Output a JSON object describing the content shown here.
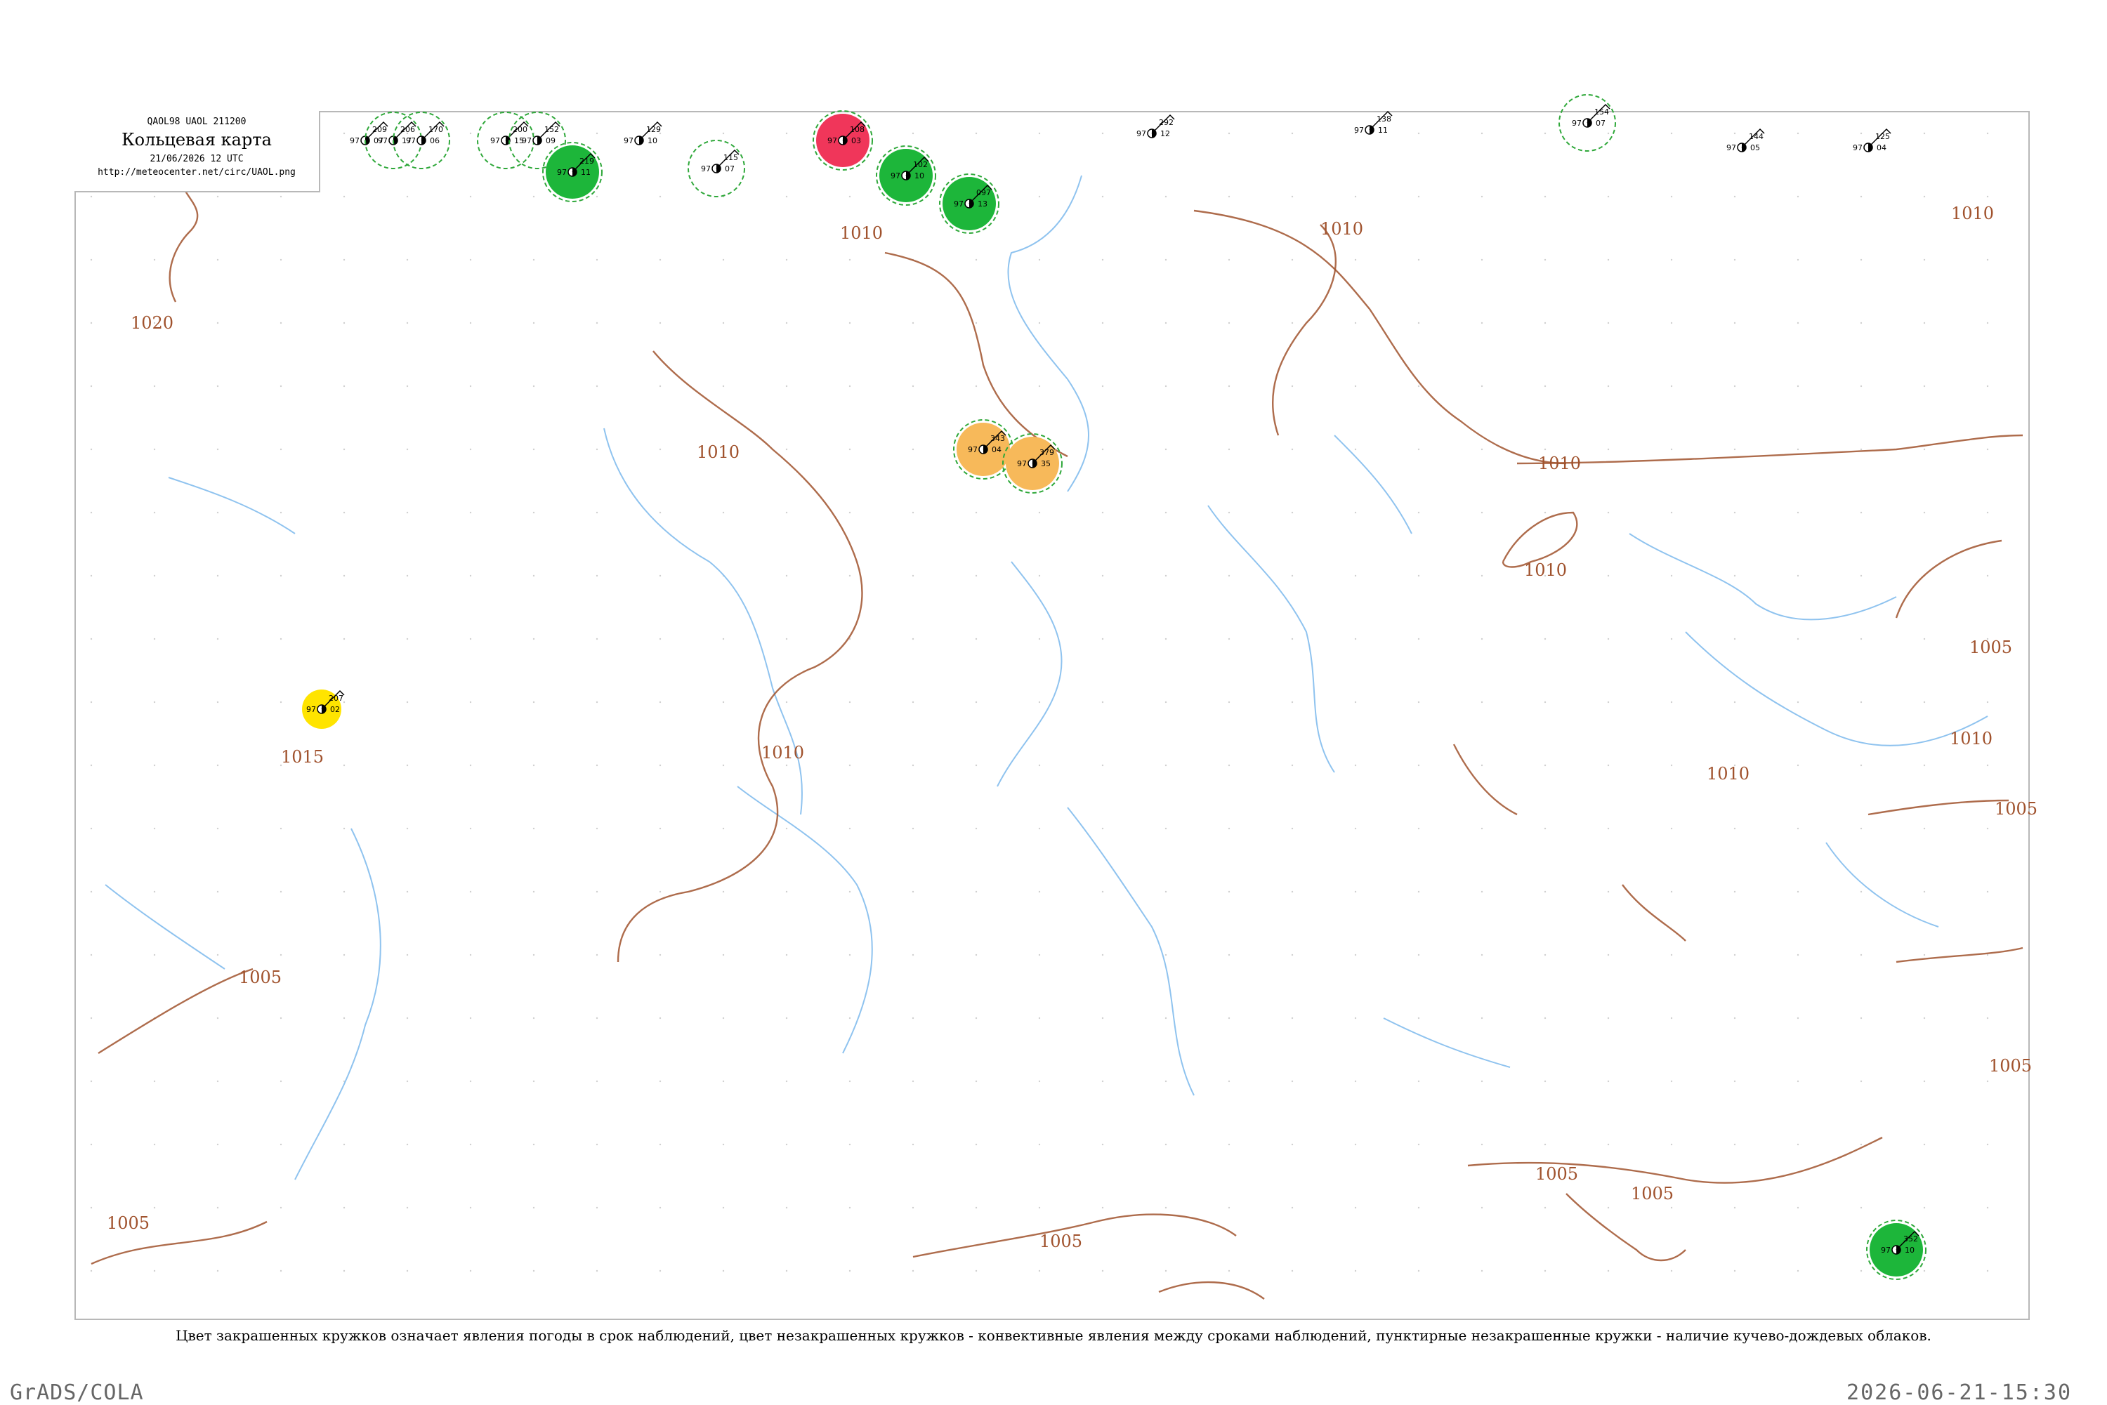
{
  "header": {
    "code_line": "QAOL98  UAOL  211200",
    "title": "Кольцевая карта",
    "date_line": "21/06/2026 12 UTC",
    "url": "http://meteocenter.net/circ/UAOL.png"
  },
  "legend_text": "Цвет закрашенных кружков означает явления погоды в срок наблюдений, цвет незакрашенных кружков - конвективные явления между сроками наблюдений, пунктирные незакрашенные кружки - наличие кучево-дождевых облаков.",
  "footer": {
    "left": "GrADS/COLA",
    "right": "2026-06-21-15:30"
  },
  "colors": {
    "filled_red": "#f0365a",
    "filled_green": "#1db63a",
    "filled_orange": "#f7b95a",
    "highlight_yellow": "#ffe400",
    "ring_green": "#2fa83a",
    "ring_red": "#d0304e",
    "isobar": "#a0522d",
    "river": "#8fc3ef"
  },
  "isobar_labels": [
    "1020",
    "1010",
    "1010",
    "1010",
    "1010",
    "1015",
    "1010",
    "1010",
    "1010",
    "1005",
    "1005",
    "1010",
    "1005",
    "1005",
    "1005",
    "1005",
    "1005",
    "1005",
    "1010"
  ],
  "stations": [
    {
      "id": "s1",
      "p": "209",
      "t": "97",
      "d": "07",
      "kind": "plain"
    },
    {
      "id": "s2",
      "p": "206",
      "t": "97",
      "d": "17",
      "kind": "ring-green"
    },
    {
      "id": "s3",
      "p": "170",
      "t": "97",
      "d": "06",
      "kind": "ring-green"
    },
    {
      "id": "s4",
      "p": "200",
      "t": "97",
      "d": "15",
      "kind": "ring-green"
    },
    {
      "id": "s5",
      "p": "152",
      "t": "97",
      "d": "09",
      "kind": "ring-green"
    },
    {
      "id": "s6",
      "p": "219",
      "t": "97",
      "d": "11",
      "kind": "filled-green"
    },
    {
      "id": "s7",
      "p": "129",
      "t": "97",
      "d": "10",
      "kind": "plain"
    },
    {
      "id": "s8",
      "p": "115",
      "t": "97",
      "d": "07",
      "kind": "ring-green"
    },
    {
      "id": "s9",
      "p": "108",
      "t": "97",
      "d": "03",
      "kind": "filled-red"
    },
    {
      "id": "s10",
      "p": "102",
      "t": "97",
      "d": "10",
      "kind": "filled-green"
    },
    {
      "id": "s11",
      "p": "097",
      "t": "97",
      "d": "13",
      "kind": "filled-green"
    },
    {
      "id": "s12",
      "p": "292",
      "t": "97",
      "d": "12",
      "kind": "plain"
    },
    {
      "id": "s13",
      "p": "138",
      "t": "97",
      "d": "11",
      "kind": "plain"
    },
    {
      "id": "s14",
      "p": "154",
      "t": "97",
      "d": "07",
      "kind": "ring-green"
    },
    {
      "id": "s15",
      "p": "144",
      "t": "97",
      "d": "05",
      "kind": "plain"
    },
    {
      "id": "s16",
      "p": "125",
      "t": "97",
      "d": "04",
      "kind": "plain"
    },
    {
      "id": "s17",
      "p": "343",
      "t": "97",
      "d": "04",
      "kind": "filled-orange"
    },
    {
      "id": "s18",
      "p": "379",
      "t": "97",
      "d": "35",
      "kind": "filled-orange"
    },
    {
      "id": "s19",
      "p": "207",
      "t": "97",
      "d": "02",
      "kind": "highlight"
    },
    {
      "id": "s20",
      "p": "352",
      "t": "97",
      "d": "10",
      "kind": "filled-green"
    }
  ]
}
